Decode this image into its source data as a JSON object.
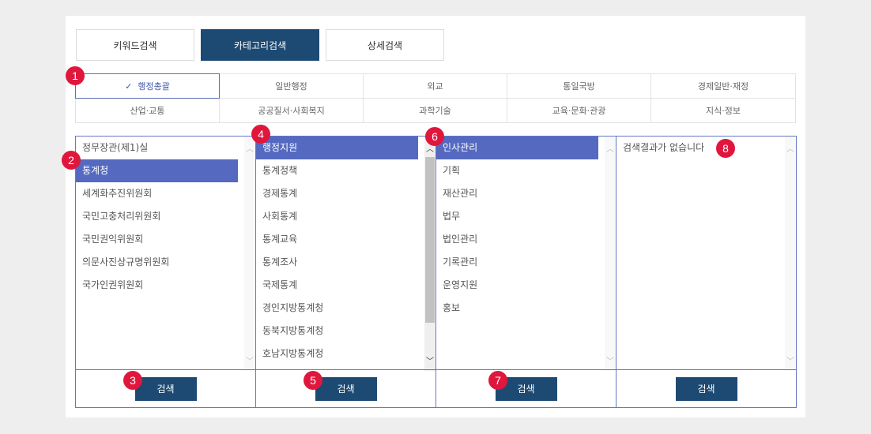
{
  "tabs": [
    {
      "label": "키워드검색"
    },
    {
      "label": "카테고리검색"
    },
    {
      "label": "상세검색"
    }
  ],
  "categories": [
    {
      "label": "행정총괄"
    },
    {
      "label": "일반행정"
    },
    {
      "label": "외교"
    },
    {
      "label": "통일국방"
    },
    {
      "label": "경제일반·재정"
    },
    {
      "label": "산업·교통"
    },
    {
      "label": "공공질서·사회복지"
    },
    {
      "label": "과학기술"
    },
    {
      "label": "교육·문화·관광"
    },
    {
      "label": "지식·정보"
    }
  ],
  "columns": [
    {
      "items": [
        "정무장관(제1)실",
        "통계청",
        "세계화추진위원회",
        "국민고충처리위원회",
        "국민권익위원회",
        "의문사진상규명위원회",
        "국가인권위원회"
      ],
      "button": "검색"
    },
    {
      "items": [
        "행정지원",
        "통계정책",
        "경제통계",
        "사회통계",
        "통계교육",
        "통계조사",
        "국제통계",
        "경인지방통계청",
        "동북지방통계청",
        "호남지방통계청"
      ],
      "button": "검색"
    },
    {
      "items": [
        "인사관리",
        "기획",
        "재산관리",
        "법무",
        "법인관리",
        "기록관리",
        "운영지원",
        "홍보"
      ],
      "button": "검색"
    },
    {
      "message": "검색결과가 없습니다",
      "button": "검색"
    }
  ],
  "badges": [
    "1",
    "2",
    "3",
    "4",
    "5",
    "6",
    "7",
    "8"
  ],
  "icons": {
    "check": "✓",
    "scroll_up": "︿",
    "scroll_down": "﹀"
  },
  "colors": {
    "tab_active": "#1d4a72",
    "selected_item": "#5469bf",
    "column_border": "#6478c4",
    "badge": "#e0173d"
  }
}
